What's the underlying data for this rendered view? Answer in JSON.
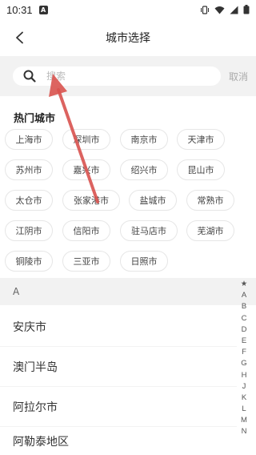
{
  "status_bar": {
    "time": "10:31",
    "notification_icon": "A",
    "icons": [
      "vibrate-icon",
      "wifi-icon",
      "signal-icon",
      "battery-icon"
    ]
  },
  "header": {
    "back_icon": "chevron-left-icon",
    "title": "城市选择"
  },
  "search": {
    "icon": "search-icon",
    "placeholder": "搜索",
    "value": "",
    "cancel_label": "取消"
  },
  "hot": {
    "title": "热门城市",
    "cities": [
      "上海市",
      "深圳市",
      "南京市",
      "天津市",
      "苏州市",
      "嘉兴市",
      "绍兴市",
      "昆山市",
      "太仓市",
      "张家港市",
      "盐城市",
      "常熟市",
      "江阴市",
      "信阳市",
      "驻马店市",
      "芜湖市",
      "铜陵市",
      "三亚市",
      "日照市"
    ]
  },
  "city_list": {
    "section_letter": "A",
    "cities": [
      "安庆市",
      "澳门半岛",
      "阿拉尔市",
      "阿勒泰地区"
    ]
  },
  "index_rail": [
    "★",
    "A",
    "B",
    "C",
    "D",
    "E",
    "F",
    "G",
    "H",
    "J",
    "K",
    "L",
    "M",
    "N"
  ],
  "colors": {
    "annotation_arrow": "#d9534f",
    "background_gray": "#f2f2f2"
  }
}
